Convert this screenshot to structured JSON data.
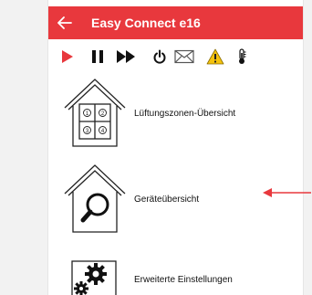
{
  "header": {
    "title": "Easy Connect e16",
    "back_icon": "arrow-left-icon",
    "background_color": "#e8383d"
  },
  "toolbar": {
    "accent_color": "#e8383d",
    "buttons": [
      {
        "name": "play-icon"
      },
      {
        "name": "pause-icon"
      },
      {
        "name": "fast-forward-icon"
      },
      {
        "name": "power-icon"
      },
      {
        "name": "envelope-icon"
      },
      {
        "name": "warning-icon"
      },
      {
        "name": "thermometer-icon"
      }
    ]
  },
  "menu": {
    "items": [
      {
        "label": "Lüftungszonen-Übersicht",
        "icon": "house-zones-icon"
      },
      {
        "label": "Geräteübersicht",
        "icon": "house-search-icon"
      },
      {
        "label": "Erweiterte Einstellungen",
        "icon": "gears-icon"
      }
    ],
    "zone_numbers": [
      "1",
      "2",
      "3",
      "4"
    ]
  },
  "annotation": {
    "arrow_color": "#e8383d",
    "icon": "pointer-arrow-icon"
  }
}
